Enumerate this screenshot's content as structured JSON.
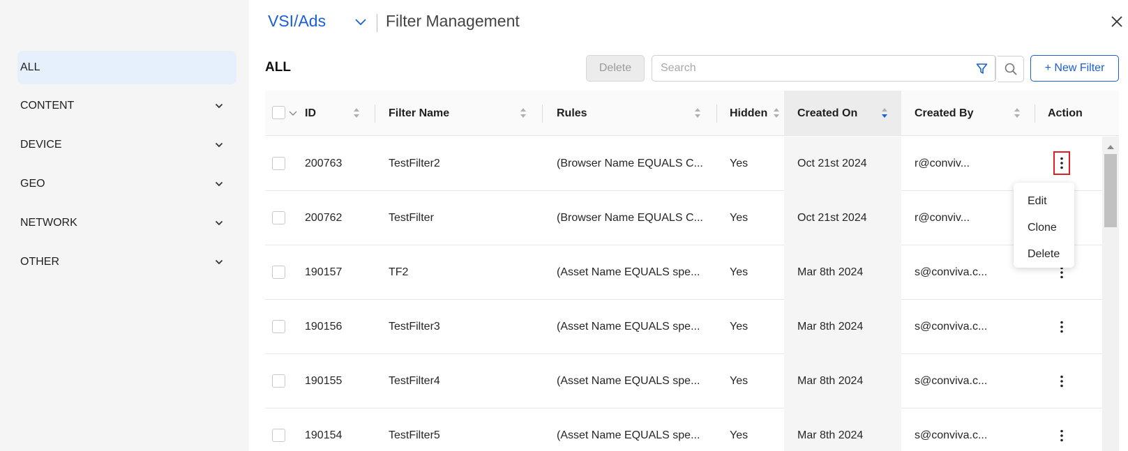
{
  "sidebar": {
    "items": [
      {
        "label": "ALL",
        "active": true
      },
      {
        "label": "CONTENT"
      },
      {
        "label": "DEVICE"
      },
      {
        "label": "GEO"
      },
      {
        "label": "NETWORK"
      },
      {
        "label": "OTHER"
      }
    ]
  },
  "header": {
    "brand": "VSI/Ads",
    "title": "Filter Management"
  },
  "toolbar": {
    "section_title": "ALL",
    "delete_label": "Delete",
    "search_placeholder": "Search",
    "new_filter_label": "+ New Filter"
  },
  "table": {
    "columns": {
      "id": "ID",
      "name": "Filter Name",
      "rules": "Rules",
      "hidden": "Hidden",
      "created_on": "Created On",
      "created_by": "Created By",
      "action": "Action"
    },
    "rows": [
      {
        "id": "200763",
        "name": "TestFilter2",
        "rules": "(Browser Name EQUALS C...",
        "hidden": "Yes",
        "created_on": "Oct 21st 2024",
        "created_by": "r@conviv..."
      },
      {
        "id": "200762",
        "name": "TestFilter",
        "rules": "(Browser Name EQUALS C...",
        "hidden": "Yes",
        "created_on": "Oct 21st 2024",
        "created_by": "r@conviv..."
      },
      {
        "id": "190157",
        "name": "TF2",
        "rules": "(Asset Name EQUALS spe...",
        "hidden": "Yes",
        "created_on": "Mar 8th 2024",
        "created_by": "s@conviva.c..."
      },
      {
        "id": "190156",
        "name": "TestFilter3",
        "rules": "(Asset Name EQUALS spe...",
        "hidden": "Yes",
        "created_on": "Mar 8th 2024",
        "created_by": "s@conviva.c..."
      },
      {
        "id": "190155",
        "name": "TestFilter4",
        "rules": "(Asset Name EQUALS spe...",
        "hidden": "Yes",
        "created_on": "Mar 8th 2024",
        "created_by": "s@conviva.c..."
      },
      {
        "id": "190154",
        "name": "TestFilter5",
        "rules": "(Asset Name EQUALS spe...",
        "hidden": "Yes",
        "created_on": "Mar 8th 2024",
        "created_by": "s@conviva.c..."
      }
    ]
  },
  "action_menu": {
    "items": [
      "Edit",
      "Clone",
      "Delete"
    ]
  },
  "colors": {
    "accent": "#1a5fd6",
    "sidebar_active": "#e6f0fd",
    "focus_outline": "#e02020"
  }
}
